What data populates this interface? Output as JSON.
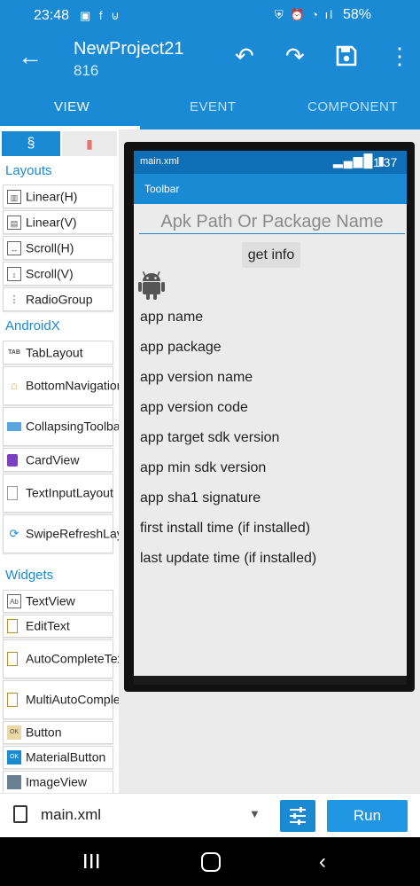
{
  "status_bar": {
    "time": "23:48",
    "left_icons": "▣ f ⊍",
    "right_icons": "⛨ ⏰ ◔ ıl",
    "battery": "58%"
  },
  "app_bar": {
    "title": "NewProject21",
    "subtitle": "816",
    "back_icon": "←",
    "undo_icon": "↶",
    "redo_icon": "↷",
    "save_icon": "💾",
    "more_icon": "⋮"
  },
  "tabs": [
    {
      "label": "VIEW",
      "active": true
    },
    {
      "label": "EVENT",
      "active": false
    },
    {
      "label": "COMPONENT",
      "active": false
    }
  ],
  "palette": {
    "tab_widgets_glyph": "§",
    "tab_bookmark_glyph": "▮",
    "sections": [
      {
        "label": "Layouts"
      },
      {
        "label": "AndroidX"
      },
      {
        "label": "Widgets"
      }
    ],
    "layouts": [
      {
        "label": "Linear(H)",
        "icon": "linear-h-icon"
      },
      {
        "label": "Linear(V)",
        "icon": "linear-v-icon"
      },
      {
        "label": "Scroll(H)",
        "icon": "scroll-h-icon"
      },
      {
        "label": "Scroll(V)",
        "icon": "scroll-v-icon"
      },
      {
        "label": "RadioGroup",
        "icon": "radiogroup-icon"
      }
    ],
    "androidx": [
      {
        "label": "TabLayout",
        "icon": "tablayout-icon"
      },
      {
        "label": "BottomNavigationView",
        "icon": "bottomnav-icon"
      },
      {
        "label": "CollapsingToolbar",
        "icon": "collapsing-toolbar-icon"
      },
      {
        "label": "CardView",
        "icon": "cardview-icon"
      },
      {
        "label": "TextInputLayout",
        "icon": "textinputlayout-icon"
      },
      {
        "label": "SwipeRefreshLayout",
        "icon": "swiperefresh-icon"
      }
    ],
    "widgets": [
      {
        "label": "TextView",
        "icon": "textview-icon"
      },
      {
        "label": "EditText",
        "icon": "edittext-icon"
      },
      {
        "label": "AutoCompleteTextView",
        "icon": "autocomplete-icon"
      },
      {
        "label": "MultiAutoCompleteTextView",
        "icon": "multiautocomplete-icon"
      },
      {
        "label": "Button",
        "icon": "button-icon"
      },
      {
        "label": "MaterialButton",
        "icon": "materialbutton-icon"
      },
      {
        "label": "ImageView",
        "icon": "imageview-icon"
      }
    ]
  },
  "preview": {
    "file_label": "main.xml",
    "clock": "1:37",
    "toolbar_label": "Toolbar",
    "input_hint": "Apk Path Or Package Name",
    "button_label": "get info",
    "info_lines": [
      "app name",
      "app package",
      "app version name",
      "app version code",
      "app target sdk version",
      "app min sdk version",
      "app sha1 signature",
      "first install time (if installed)",
      "last update time (if installed)"
    ]
  },
  "bottom_bar": {
    "file_name": "main.xml",
    "caret": "▼",
    "run_label": "Run"
  },
  "colors": {
    "primary": "#1a8ad4",
    "preview_status": "#0f6fb6",
    "run_button": "#2196e3",
    "android_green_gray": "#555555"
  }
}
